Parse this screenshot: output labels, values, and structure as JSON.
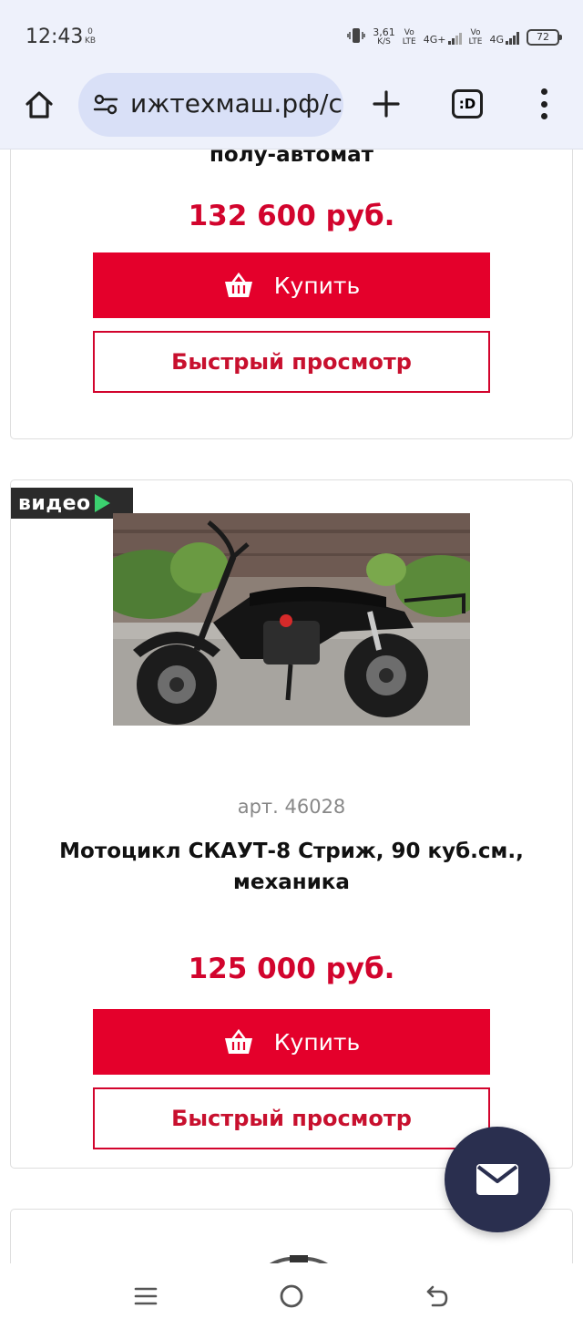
{
  "status_bar": {
    "time": "12:43",
    "data_kb": "0",
    "data_kb_unit": "KB",
    "speed": "3,61",
    "speed_unit": "K/S",
    "sim1_vo": "Vo",
    "sim1_lte": "LTE",
    "net1": "4G+",
    "sim2_vo": "Vo",
    "sim2_lte": "LTE",
    "net2": "4G",
    "battery": "72"
  },
  "browser": {
    "url": "ижтехмаш.рф/c",
    "tab_count_label": ":D",
    "icons": [
      "home-icon",
      "site-settings-icon",
      "plus-icon",
      "tabs-icon",
      "more-vert-icon"
    ]
  },
  "product_1": {
    "title_fragment": "полу-автомат",
    "price": "132 600 руб.",
    "buy_label": "Купить",
    "quick_view_label": "Быстрый просмотр"
  },
  "product_2": {
    "video_badge": "видео",
    "article": "арт. 46028",
    "title_line1": "Мотоцикл СКАУТ-8 Стриж, 90 куб.см.,",
    "title_line2": "механика",
    "price": "125 000 руб.",
    "buy_label": "Купить",
    "quick_view_label": "Быстрый просмотр"
  },
  "colors": {
    "accent_red": "#e4002b",
    "price_red": "#d2042d",
    "fab": "#2a2f4f"
  }
}
